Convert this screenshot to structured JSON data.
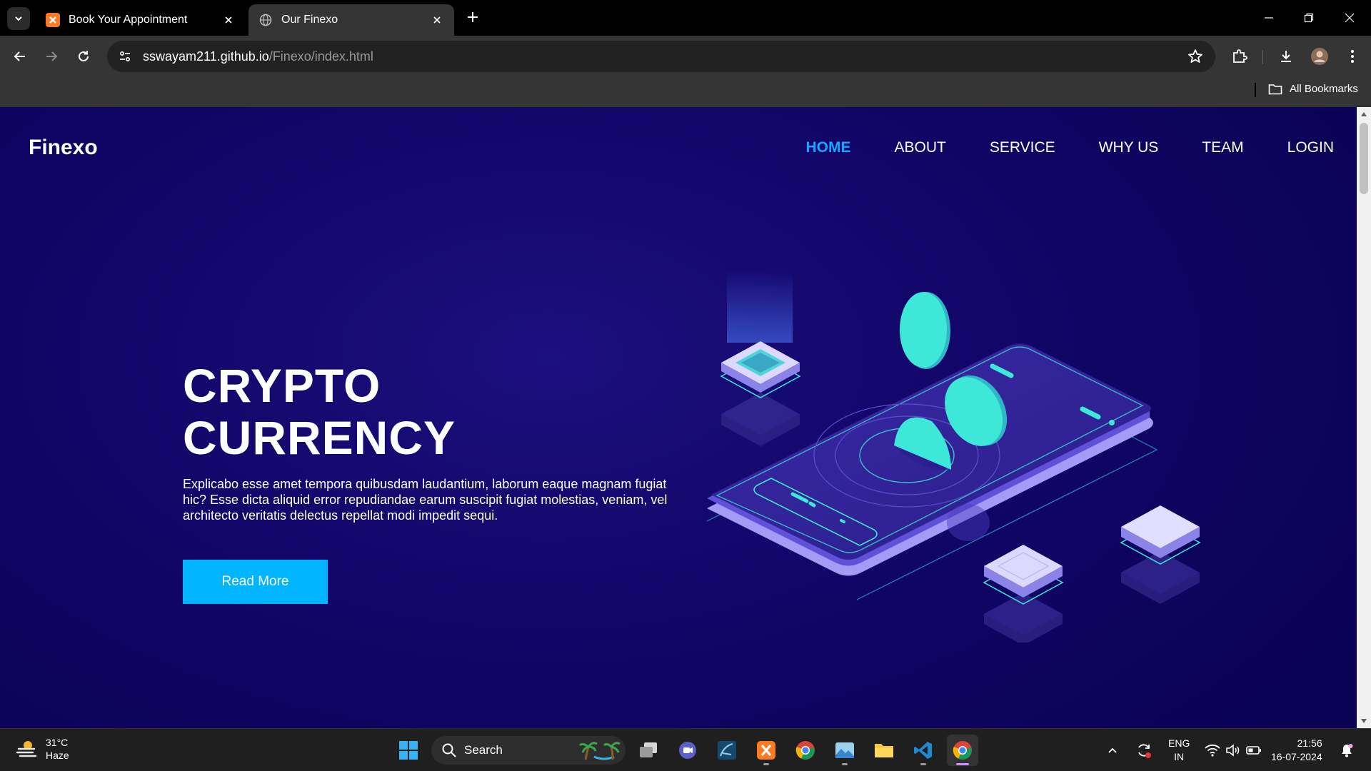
{
  "browser": {
    "tabs": [
      {
        "title": "Book Your Appointment",
        "active": false,
        "favicon": "xampp-icon"
      },
      {
        "title": "Our Finexo",
        "active": true,
        "favicon": "globe-icon"
      }
    ],
    "url_host": "sswayam211.github.io",
    "url_path": "/Finexo/index.html",
    "bookmarks_label": "All Bookmarks"
  },
  "site": {
    "brand": "Finexo",
    "nav": [
      {
        "label": "HOME",
        "active": true
      },
      {
        "label": "ABOUT",
        "active": false
      },
      {
        "label": "SERVICE",
        "active": false
      },
      {
        "label": "WHY US",
        "active": false
      },
      {
        "label": "TEAM",
        "active": false
      },
      {
        "label": "LOGIN",
        "active": false
      }
    ],
    "hero": {
      "title_line1": "CRYPTO",
      "title_line2": "CURRENCY",
      "text": "Explicabo esse amet tempora quibusdam laudantium, laborum eaque magnam fugiat hic? Esse dicta aliquid error repudiandae earum suscipit fugiat molestias, veniam, vel architecto veritatis delectus repellat modi impedit sequi.",
      "button": "Read More"
    },
    "colors": {
      "accent": "#14a8ff",
      "button": "#00b4ff",
      "background": "#120669",
      "coin": "#3ee8d8"
    }
  },
  "taskbar": {
    "weather_temp": "31°C",
    "weather_desc": "Haze",
    "search_label": "Search",
    "lang_line1": "ENG",
    "lang_line2": "IN",
    "time": "21:56",
    "date": "16-07-2024"
  }
}
